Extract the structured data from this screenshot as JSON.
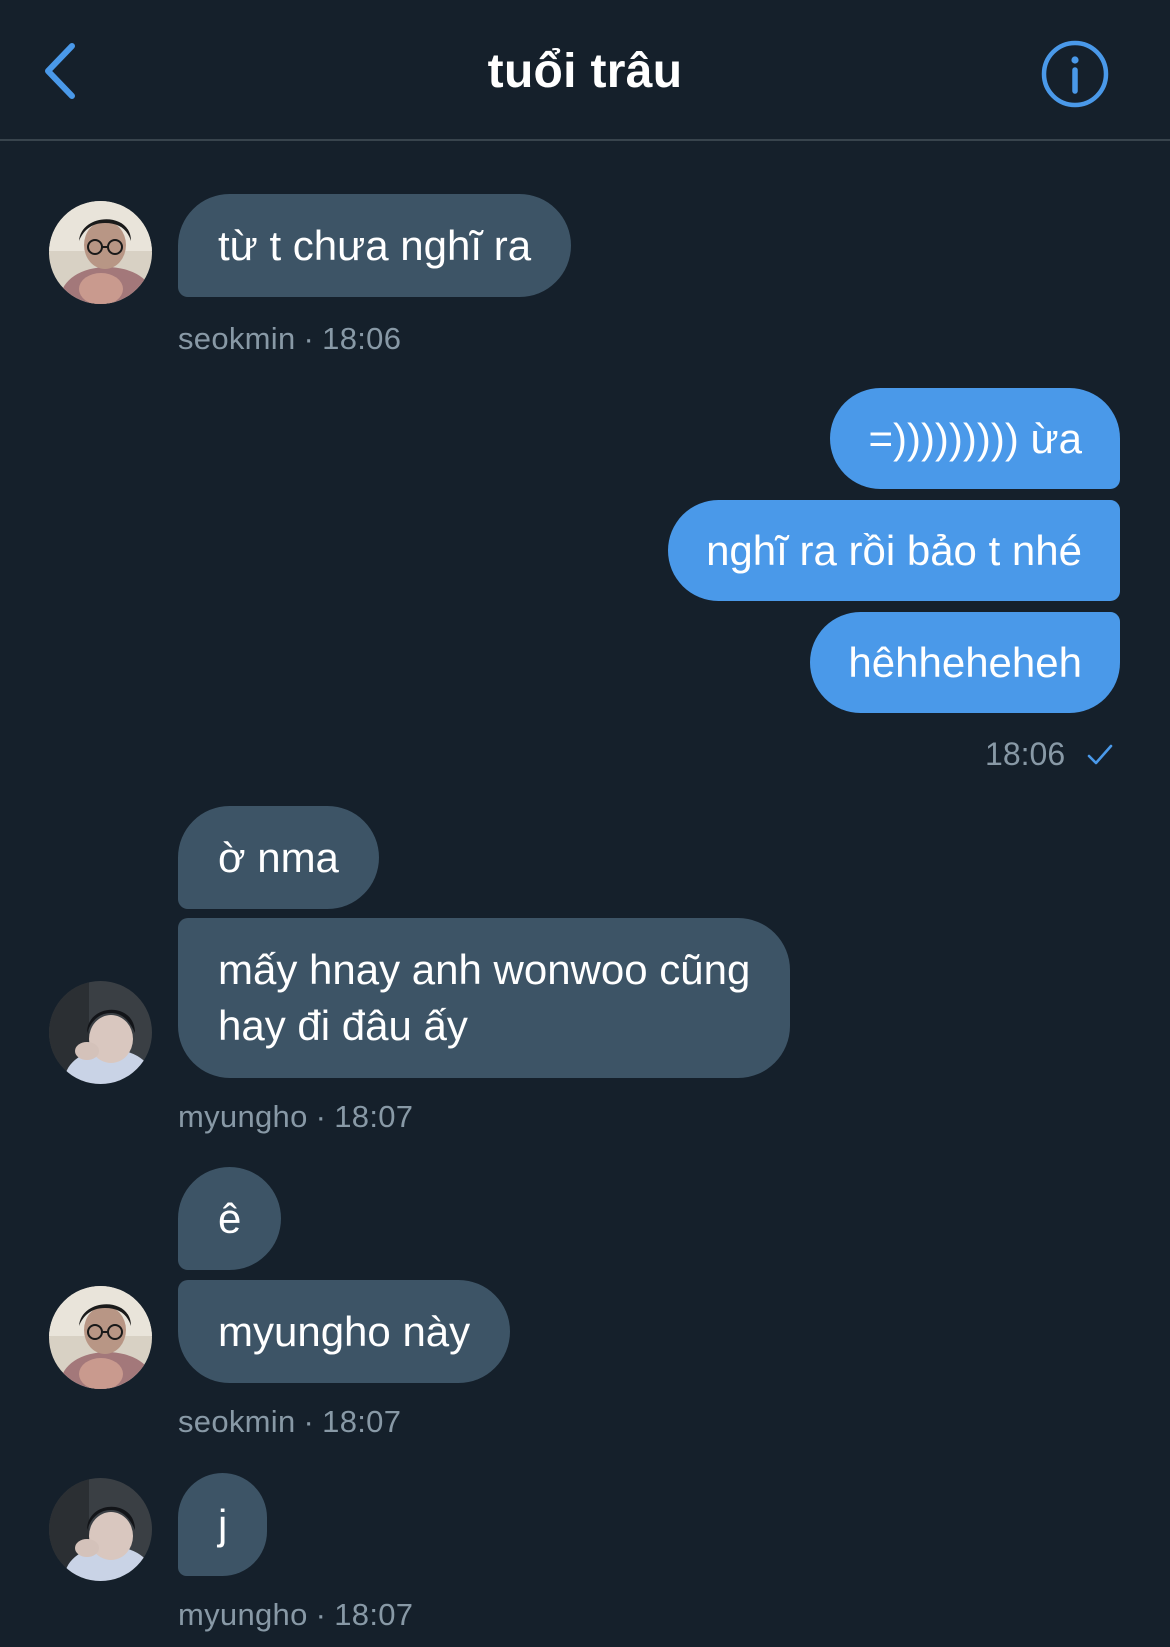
{
  "header": {
    "title": "tuổi trâu",
    "back_icon": "chevron-left-icon",
    "info_icon": "info-icon"
  },
  "colors": {
    "background": "#15202b",
    "incoming_bubble": "#3d5466",
    "outgoing_bubble": "#4a99e9",
    "accent": "#4a99e9",
    "meta_text": "#8899a6"
  },
  "messages": [
    {
      "sender": "seokmin",
      "direction": "incoming",
      "text": "từ t chưa nghĩ ra"
    },
    {
      "sender": "me",
      "direction": "outgoing",
      "text": "=))))))))) ừa"
    },
    {
      "sender": "me",
      "direction": "outgoing",
      "text": "nghĩ ra rồi bảo t nhé"
    },
    {
      "sender": "me",
      "direction": "outgoing",
      "text": "hêhheheheh"
    },
    {
      "sender": "myungho",
      "direction": "incoming",
      "text": "ờ nma"
    },
    {
      "sender": "myungho",
      "direction": "incoming",
      "text_line1": "mấy hnay anh wonwoo cũng",
      "text_line2": "hay đi đâu ấy"
    },
    {
      "sender": "seokmin",
      "direction": "incoming",
      "text": "ê"
    },
    {
      "sender": "seokmin",
      "direction": "incoming",
      "text": "myungho này"
    },
    {
      "sender": "myungho",
      "direction": "incoming",
      "text": "j"
    }
  ],
  "meta": [
    {
      "name": "seokmin",
      "sep": "·",
      "time": "18:06"
    },
    {
      "time": "18:06",
      "status_icon": "check-icon"
    },
    {
      "name": "myungho",
      "sep": "·",
      "time": "18:07"
    },
    {
      "name": "seokmin",
      "sep": "·",
      "time": "18:07"
    },
    {
      "name": "myungho",
      "sep": "·",
      "time": "18:07"
    }
  ]
}
